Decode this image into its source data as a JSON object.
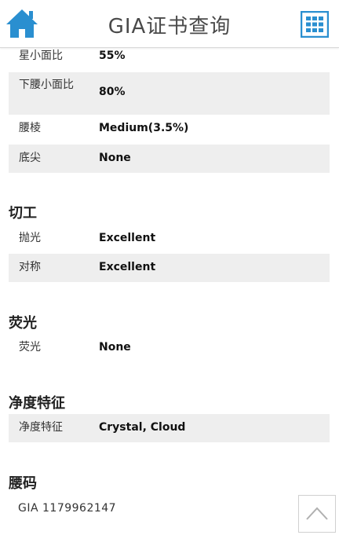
{
  "header": {
    "title": "GIA证书查询",
    "home_icon": "home-icon",
    "menu_icon": "grid-menu-icon",
    "accent": "#2a8fd0"
  },
  "proportions": {
    "rows": [
      {
        "label": "星小面比",
        "value": "55%"
      },
      {
        "label": "下腰小面比",
        "value": "80%"
      },
      {
        "label": "腰棱",
        "value": "Medium(3.5%)"
      },
      {
        "label": "底尖",
        "value": "None"
      }
    ]
  },
  "cut": {
    "title": "切工",
    "rows": [
      {
        "label": "抛光",
        "value": "Excellent"
      },
      {
        "label": "对称",
        "value": "Excellent"
      }
    ]
  },
  "fluorescence": {
    "title": "荧光",
    "rows": [
      {
        "label": "荧光",
        "value": "None"
      }
    ]
  },
  "clarity": {
    "title": "净度特征",
    "rows": [
      {
        "label": "净度特征",
        "value": "Crystal, Cloud"
      }
    ]
  },
  "inscription": {
    "title": "腰码",
    "value": "GIA 1179962147"
  },
  "back_to_top_icon": "chevron-up-icon"
}
